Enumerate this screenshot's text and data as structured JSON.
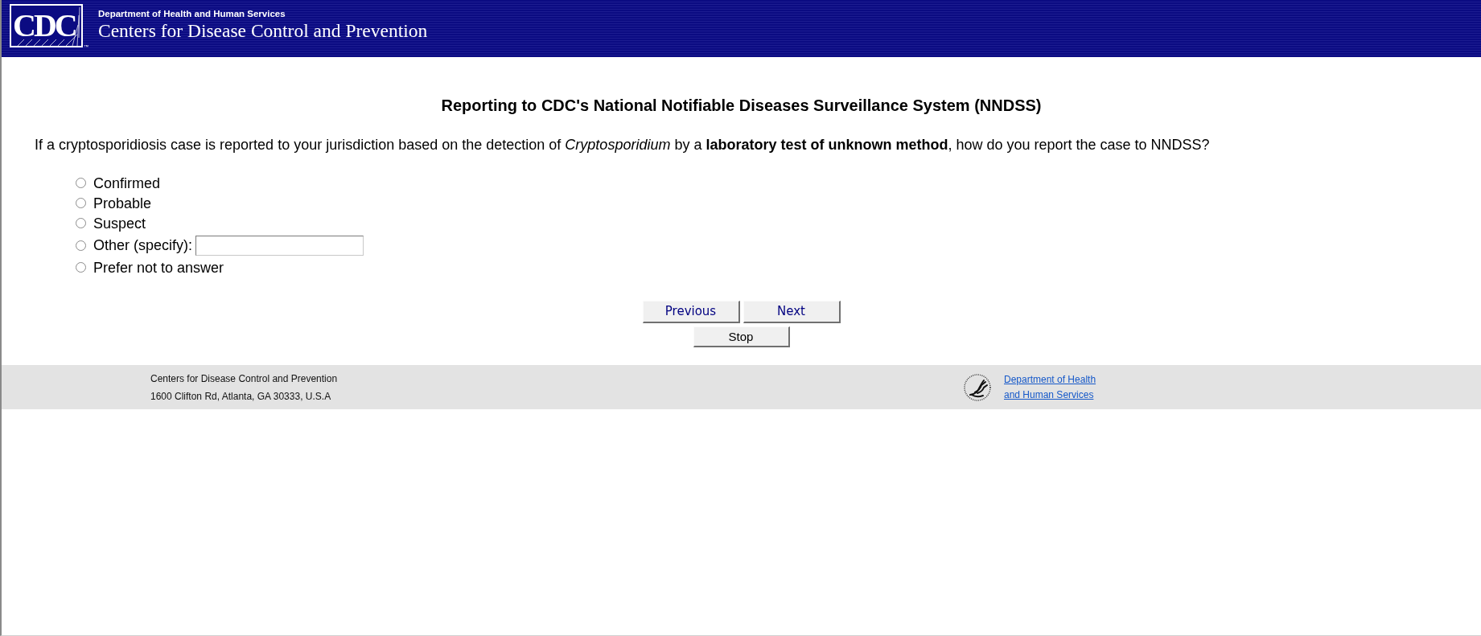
{
  "header": {
    "logo": "CDC",
    "trademark": "™",
    "department": "Department of Health and Human Services",
    "agency": "Centers for Disease Control and Prevention"
  },
  "title": "Reporting to CDC's National Notifiable Diseases Surveillance System (NNDSS)",
  "question": "If a cryptosporidiosis case is reported to your jurisdiction based on the detection of *Cryptosporidium* by a **laboratory test of unknown method**, how do you report the case to NNDSS?",
  "options": [
    {
      "label": "Confirmed",
      "kind": "plain",
      "selected": false
    },
    {
      "label": "Probable",
      "kind": "plain",
      "selected": false
    },
    {
      "label": "Suspect",
      "kind": "plain",
      "selected": false
    },
    {
      "label": "Other (specify):",
      "kind": "specify",
      "selected": false
    },
    {
      "label": "Prefer not to answer",
      "kind": "plain",
      "selected": false
    }
  ],
  "buttons": [
    {
      "label": "Previous",
      "kind": "nav"
    },
    {
      "label": "Next",
      "kind": "nav"
    },
    {
      "label": "Stop",
      "kind": "stop"
    }
  ],
  "footer": {
    "address_lines": [
      "Centers for Disease Control and Prevention",
      "1600 Clifton Rd, Atlanta, GA 30333, U.S.A"
    ],
    "link": "Department of Health and Human Services"
  }
}
